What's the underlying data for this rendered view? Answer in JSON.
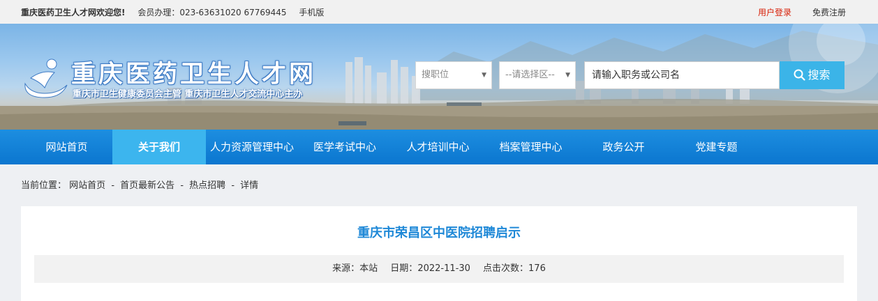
{
  "topbar": {
    "welcome": "重庆医药卫生人才网欢迎您!",
    "member": "会员办理：023-63631020 67769445",
    "mobile": "手机版",
    "login": "用户登录",
    "register": "免费注册",
    "login_color": "#d81e06"
  },
  "banner": {
    "logo_title": "重庆医药卫生人才网",
    "logo_subtitle": "重庆市卫生健康委员会主管 重庆市卫生人才交流中心主办",
    "search": {
      "position_select": "搜职位",
      "area_select": "--请选择区--",
      "keyword_placeholder": "请输入职务或公司名",
      "button_label": "搜索"
    }
  },
  "nav": {
    "items": [
      {
        "label": "网站首页"
      },
      {
        "label": "关于我们"
      },
      {
        "label": "人力资源管理中心"
      },
      {
        "label": "医学考试中心"
      },
      {
        "label": "人才培训中心"
      },
      {
        "label": "档案管理中心"
      },
      {
        "label": "政务公开"
      },
      {
        "label": "党建专题"
      }
    ],
    "active_index": 1,
    "bg_color": "#0b76cf",
    "active_color": "#3cb5ee"
  },
  "breadcrumb": {
    "prefix": "当前位置：",
    "items": [
      "网站首页",
      "首页最新公告",
      "热点招聘",
      "详情"
    ],
    "separator": "-"
  },
  "article": {
    "title": "重庆市荣昌区中医院招聘启示",
    "title_color": "#1e88d7",
    "source_label": "来源：",
    "source": "本站",
    "date_label": "日期：",
    "date": "2022-11-30",
    "clicks_label": "点击次数：",
    "clicks": "176"
  },
  "icons": {
    "logo": "runner-logo-icon",
    "search": "search-icon",
    "dropdown": "chevron-down-icon"
  }
}
